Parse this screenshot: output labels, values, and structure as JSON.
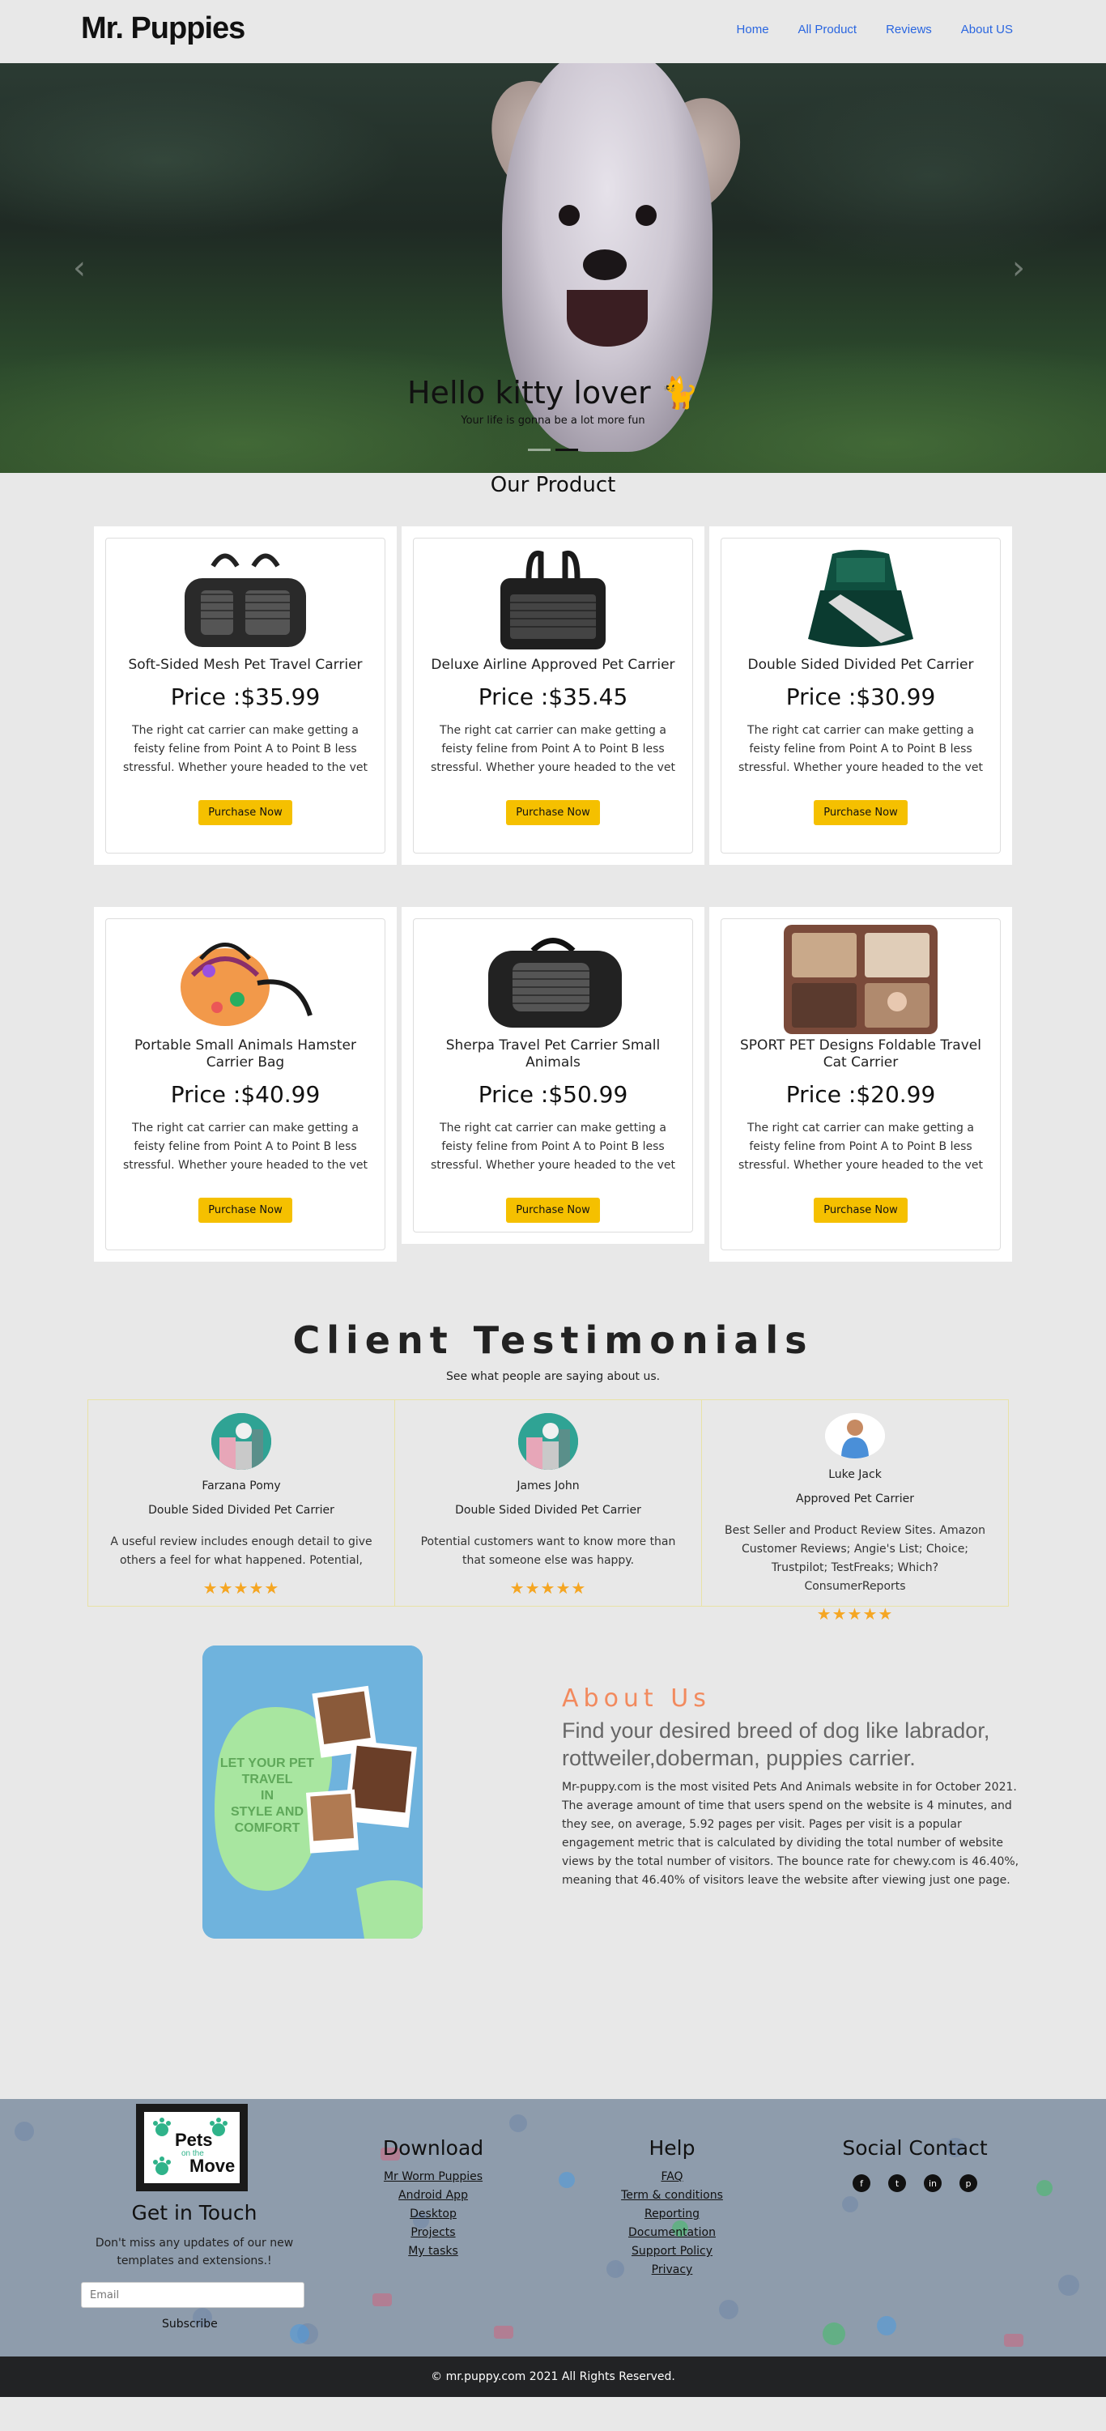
{
  "nav": {
    "brand": "Mr. Puppies",
    "links": [
      "Home",
      "All Product",
      "Reviews",
      "About US"
    ]
  },
  "hero": {
    "title": "Hello kitty lover 🐈",
    "subtitle": "Your life is gonna be a lot more fun"
  },
  "products": {
    "title": "Our Product",
    "description": "The right cat carrier can make getting a feisty feline from Point A to Point B less stressful. Whether youre headed to the vet",
    "button_label": "Purchase Now",
    "items": [
      {
        "name": "Soft-Sided Mesh Pet Travel Carrier",
        "price": "Price :$35.99"
      },
      {
        "name": "Deluxe Airline Approved Pet Carrier",
        "price": "Price :$35.45"
      },
      {
        "name": "Double Sided Divided Pet Carrier",
        "price": "Price :$30.99"
      },
      {
        "name": "Portable Small Animals Hamster Carrier Bag",
        "price": "Price :$40.99"
      },
      {
        "name": "Sherpa Travel Pet Carrier Small Animals",
        "price": "Price :$50.99"
      },
      {
        "name": "SPORT PET Designs Foldable Travel Cat Carrier",
        "price": "Price :$20.99"
      }
    ]
  },
  "testimonials": {
    "title": "Client Testimonials",
    "subtitle": "See what people are saying about us.",
    "items": [
      {
        "name": "Farzana Pomy",
        "product": "Double Sided Divided Pet Carrier",
        "text": "A useful review includes enough detail to give others a feel for what happened. Potential,",
        "stars": "★★★★★"
      },
      {
        "name": "James John",
        "product": "Double Sided Divided Pet Carrier",
        "text": "Potential customers want to know more than that someone else was happy.",
        "stars": "★★★★★"
      },
      {
        "name": "Luke Jack",
        "product": "Approved Pet Carrier",
        "text": "Best Seller and Product Review Sites. Amazon Customer Reviews; Angie's List; Choice; Trustpilot; TestFreaks; Which? ConsumerReports",
        "stars": "★★★★★"
      }
    ]
  },
  "about": {
    "title": "About Us",
    "subtitle": "Find your desired breed of dog like labrador, rottweiler,doberman, puppies carrier.",
    "body": "Mr-puppy.com is the most visited Pets And Animals website in for October 2021. The average amount of time that users spend on the website is 4 minutes, and they see, on average, 5.92 pages per visit. Pages per visit is a popular engagement metric that is calculated by dividing the total number of website views by the total number of visitors. The bounce rate for chewy.com is 46.40%, meaning that 46.40% of visitors leave the website after viewing just one page.",
    "image_text": "LET YOUR PET TRAVEL IN STYLE AND COMFORT"
  },
  "footer": {
    "logo_text_1": "Pets",
    "logo_text_2": "on the",
    "logo_text_3": "Move",
    "get_in_touch": "Get in Touch",
    "get_in_touch_text": "Don't miss any updates of our new templates and extensions.!",
    "email_placeholder": "Email",
    "subscribe": "Subscribe",
    "download_title": "Download",
    "download_links": [
      "Mr Worm Puppies",
      "Android App",
      "Desktop",
      "Projects",
      "My tasks"
    ],
    "help_title": "Help",
    "help_links": [
      "FAQ",
      "Term & conditions",
      "Reporting",
      "Documentation",
      "Support Policy",
      "Privacy"
    ],
    "social_title": "Social Contact",
    "social_icons": [
      "facebook-icon",
      "twitter-icon",
      "linkedin-icon",
      "pinterest-icon"
    ]
  },
  "copyright": "© mr.puppy.com 2021 All Rights Reserved."
}
